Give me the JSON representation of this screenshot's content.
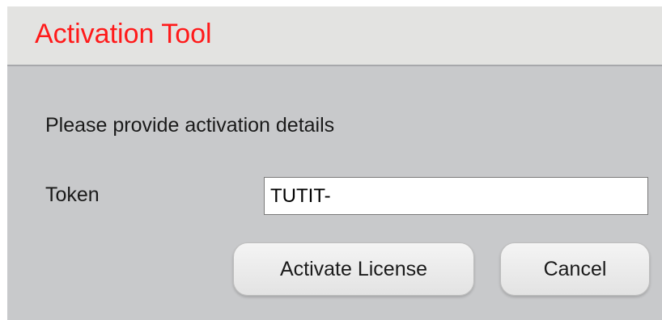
{
  "dialog": {
    "title": "Activation Tool",
    "prompt": "Please provide activation details",
    "token_label": "Token",
    "token_value": "TUTIT-",
    "activate_label": "Activate License",
    "cancel_label": "Cancel"
  },
  "colors": {
    "title": "#ff1a1a",
    "dialog_background": "#c8c9cb",
    "titlebar_background": "#e3e3e1"
  }
}
